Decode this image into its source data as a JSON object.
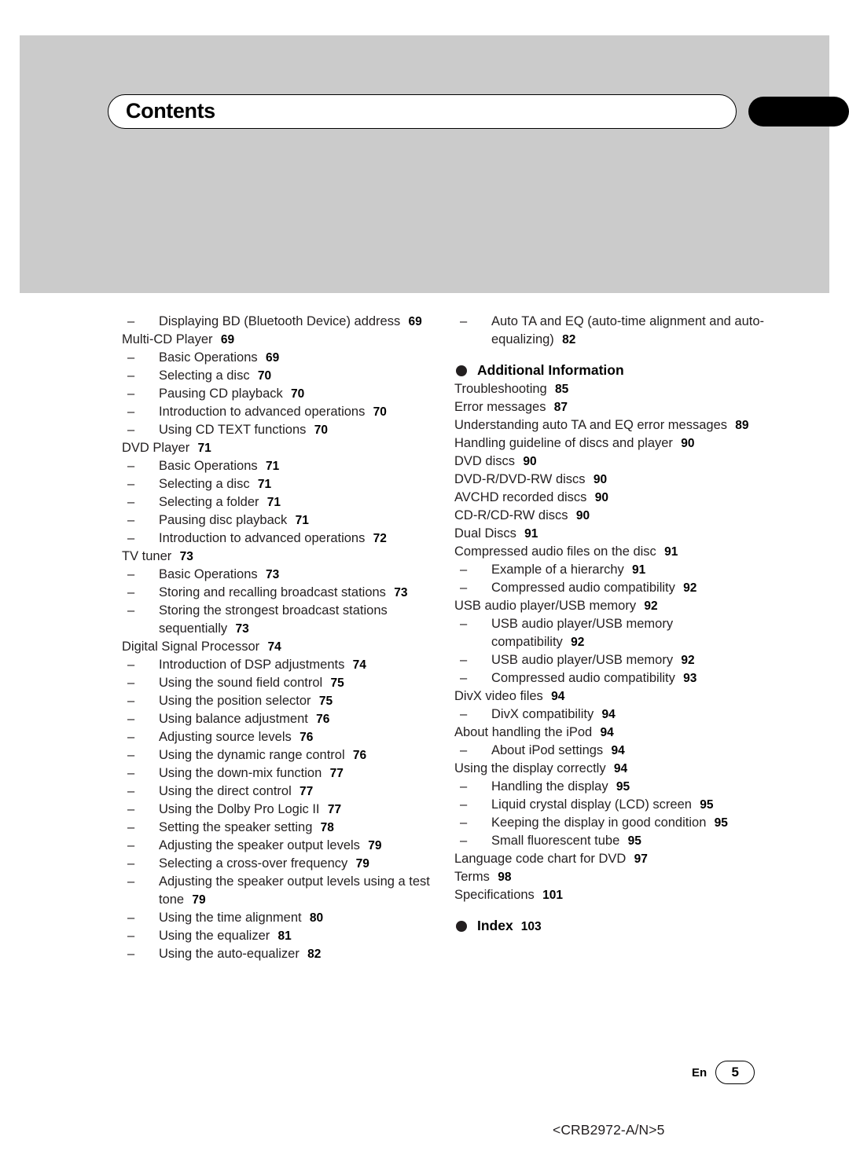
{
  "page": {
    "title": "Contents",
    "language_code": "En",
    "page_number": "5",
    "document_code": "<CRB2972-A/N>5"
  },
  "toc": {
    "left_column": [
      {
        "level": 1,
        "text": "Displaying BD (Bluetooth Device) address",
        "page": "69"
      },
      {
        "level": 0,
        "text": "Multi-CD Player",
        "page": "69"
      },
      {
        "level": 1,
        "text": "Basic Operations",
        "page": "69"
      },
      {
        "level": 1,
        "text": "Selecting a disc",
        "page": "70"
      },
      {
        "level": 1,
        "text": "Pausing CD playback",
        "page": "70"
      },
      {
        "level": 1,
        "text": "Introduction to advanced operations",
        "page": "70"
      },
      {
        "level": 1,
        "text": "Using CD TEXT functions",
        "page": "70"
      },
      {
        "level": 0,
        "text": "DVD Player",
        "page": "71"
      },
      {
        "level": 1,
        "text": "Basic Operations",
        "page": "71"
      },
      {
        "level": 1,
        "text": "Selecting a disc",
        "page": "71"
      },
      {
        "level": 1,
        "text": "Selecting a folder",
        "page": "71"
      },
      {
        "level": 1,
        "text": "Pausing disc playback",
        "page": "71"
      },
      {
        "level": 1,
        "text": "Introduction to advanced operations",
        "page": "72"
      },
      {
        "level": 0,
        "text": "TV tuner",
        "page": "73"
      },
      {
        "level": 1,
        "text": "Basic Operations",
        "page": "73"
      },
      {
        "level": 1,
        "text": "Storing and recalling broadcast stations",
        "page": "73"
      },
      {
        "level": 1,
        "text": "Storing the strongest broadcast stations sequentially",
        "page": "73"
      },
      {
        "level": 0,
        "text": "Digital Signal Processor",
        "page": "74"
      },
      {
        "level": 1,
        "text": "Introduction of DSP adjustments",
        "page": "74"
      },
      {
        "level": 1,
        "text": "Using the sound field control",
        "page": "75"
      },
      {
        "level": 1,
        "text": "Using the position selector",
        "page": "75"
      },
      {
        "level": 1,
        "text": "Using balance adjustment",
        "page": "76"
      },
      {
        "level": 1,
        "text": "Adjusting source levels",
        "page": "76"
      },
      {
        "level": 1,
        "text": "Using the dynamic range control",
        "page": "76"
      },
      {
        "level": 1,
        "text": "Using the down-mix function",
        "page": "77"
      },
      {
        "level": 1,
        "text": "Using the direct control",
        "page": "77"
      },
      {
        "level": 1,
        "text": "Using the Dolby Pro Logic II",
        "page": "77"
      },
      {
        "level": 1,
        "text": "Setting the speaker setting",
        "page": "78"
      },
      {
        "level": 1,
        "text": "Adjusting the speaker output levels",
        "page": "79"
      },
      {
        "level": 1,
        "text": "Selecting a cross-over frequency",
        "page": "79"
      },
      {
        "level": 1,
        "text": "Adjusting the speaker output levels using a test tone",
        "page": "79"
      },
      {
        "level": 1,
        "text": "Using the time alignment",
        "page": "80"
      },
      {
        "level": 1,
        "text": "Using the equalizer",
        "page": "81"
      },
      {
        "level": 1,
        "text": "Using the auto-equalizer",
        "page": "82"
      }
    ],
    "right_column_top": [
      {
        "level": 1,
        "text": "Auto TA and EQ (auto-time alignment and auto-equalizing)",
        "page": "82"
      }
    ],
    "sections": [
      {
        "heading": "Additional Information",
        "heading_page": "",
        "entries": [
          {
            "level": 0,
            "text": "Troubleshooting",
            "page": "85"
          },
          {
            "level": 0,
            "text": "Error messages",
            "page": "87"
          },
          {
            "level": 0,
            "text": "Understanding auto TA and EQ error messages",
            "page": "89"
          },
          {
            "level": 0,
            "text": "Handling guideline of discs and player",
            "page": "90"
          },
          {
            "level": 0,
            "text": "DVD discs",
            "page": "90"
          },
          {
            "level": 0,
            "text": "DVD-R/DVD-RW discs",
            "page": "90"
          },
          {
            "level": 0,
            "text": "AVCHD recorded discs",
            "page": "90"
          },
          {
            "level": 0,
            "text": "CD-R/CD-RW discs",
            "page": "90"
          },
          {
            "level": 0,
            "text": "Dual Discs",
            "page": "91"
          },
          {
            "level": 0,
            "text": "Compressed audio files on the disc",
            "page": "91"
          },
          {
            "level": 1,
            "text": "Example of a hierarchy",
            "page": "91"
          },
          {
            "level": 1,
            "text": "Compressed audio compatibility",
            "page": "92"
          },
          {
            "level": 0,
            "text": "USB audio player/USB memory",
            "page": "92"
          },
          {
            "level": 1,
            "text": "USB audio player/USB memory compatibility",
            "page": "92"
          },
          {
            "level": 1,
            "text": "USB audio player/USB memory",
            "page": "92"
          },
          {
            "level": 1,
            "text": "Compressed audio compatibility",
            "page": "93"
          },
          {
            "level": 0,
            "text": "DivX video files",
            "page": "94"
          },
          {
            "level": 1,
            "text": "DivX compatibility",
            "page": "94"
          },
          {
            "level": 0,
            "text": "About handling the iPod",
            "page": "94"
          },
          {
            "level": 1,
            "text": "About iPod settings",
            "page": "94"
          },
          {
            "level": 0,
            "text": "Using the display correctly",
            "page": "94"
          },
          {
            "level": 1,
            "text": "Handling the display",
            "page": "95"
          },
          {
            "level": 1,
            "text": "Liquid crystal display (LCD) screen",
            "page": "95"
          },
          {
            "level": 1,
            "text": "Keeping the display in good condition",
            "page": "95"
          },
          {
            "level": 1,
            "text": "Small fluorescent tube",
            "page": "95"
          },
          {
            "level": 0,
            "text": "Language code chart for DVD",
            "page": "97"
          },
          {
            "level": 0,
            "text": "Terms",
            "page": "98"
          },
          {
            "level": 0,
            "text": "Specifications",
            "page": "101"
          }
        ]
      },
      {
        "heading": "Index",
        "heading_page": "103",
        "entries": []
      }
    ]
  },
  "colors": {
    "band": "#cbcbcb",
    "text": "#231f20",
    "accent": "#000000"
  }
}
